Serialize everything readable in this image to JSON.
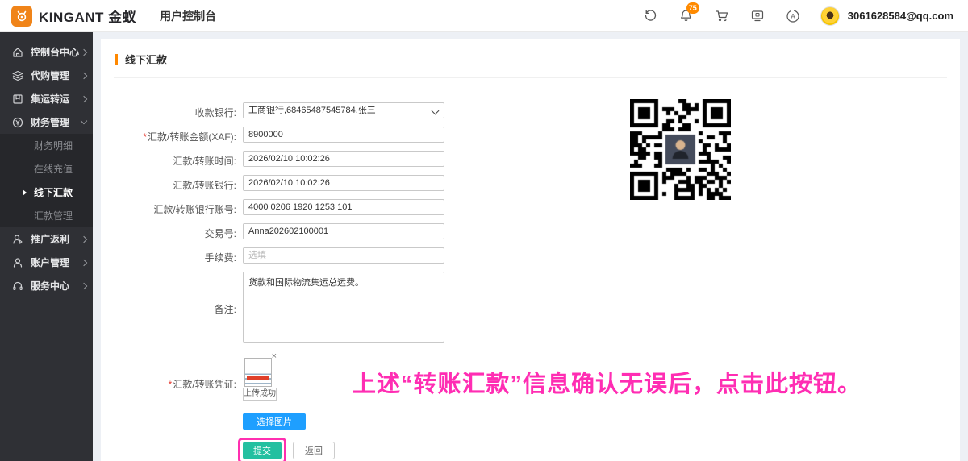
{
  "header": {
    "logo_text": "KINGANT 金蚁",
    "app_title": "用户控制台",
    "notification_count": "75",
    "user_email": "3061628584@qq.com"
  },
  "sidebar": {
    "items": [
      {
        "label": "控制台中心"
      },
      {
        "label": "代购管理"
      },
      {
        "label": "集运转运"
      },
      {
        "label": "财务管理"
      },
      {
        "label": "推广返利"
      },
      {
        "label": "账户管理"
      },
      {
        "label": "服务中心"
      }
    ],
    "finance_submenu": [
      {
        "label": "财务明细"
      },
      {
        "label": "在线充值"
      },
      {
        "label": "线下汇款"
      },
      {
        "label": "汇款管理"
      }
    ]
  },
  "page": {
    "title": "线下汇款"
  },
  "form": {
    "required_mark": "*",
    "bank_label": "收款银行:",
    "bank_value": "工商银行,68465487545784,张三",
    "amount_label": "汇款/转账金额(XAF):",
    "amount_value": "8900000",
    "time_label": "汇款/转账时间:",
    "time_value": "2026/02/10 10:02:26",
    "bank2_label": "汇款/转账银行:",
    "bank2_value": "2026/02/10 10:02:26",
    "account_label": "汇款/转账银行账号:",
    "account_value": "4000 0206 1920 1253 101",
    "trade_label": "交易号:",
    "trade_value": "Anna202602100001",
    "fee_label": "手续费:",
    "fee_placeholder": "选填",
    "remark_label": "备注:",
    "remark_value": "货款和国际物流集运总运费。",
    "voucher_label": "汇款/转账凭证:",
    "upload_status": "上传成功",
    "choose_image_label": "选择图片",
    "submit_label": "提交",
    "back_label": "返回"
  },
  "annotation": {
    "text": "上述“转账汇款”信息确认无误后，点击此按钮。"
  },
  "colors": {
    "accent_orange": "#ff8800",
    "brand_orange": "#f08419",
    "button_blue": "#1e9fff",
    "button_green": "#23c0a0",
    "highlight_pink": "#ff2fb0",
    "sidebar_bg": "#2f3035",
    "submenu_bg": "#26272b"
  }
}
